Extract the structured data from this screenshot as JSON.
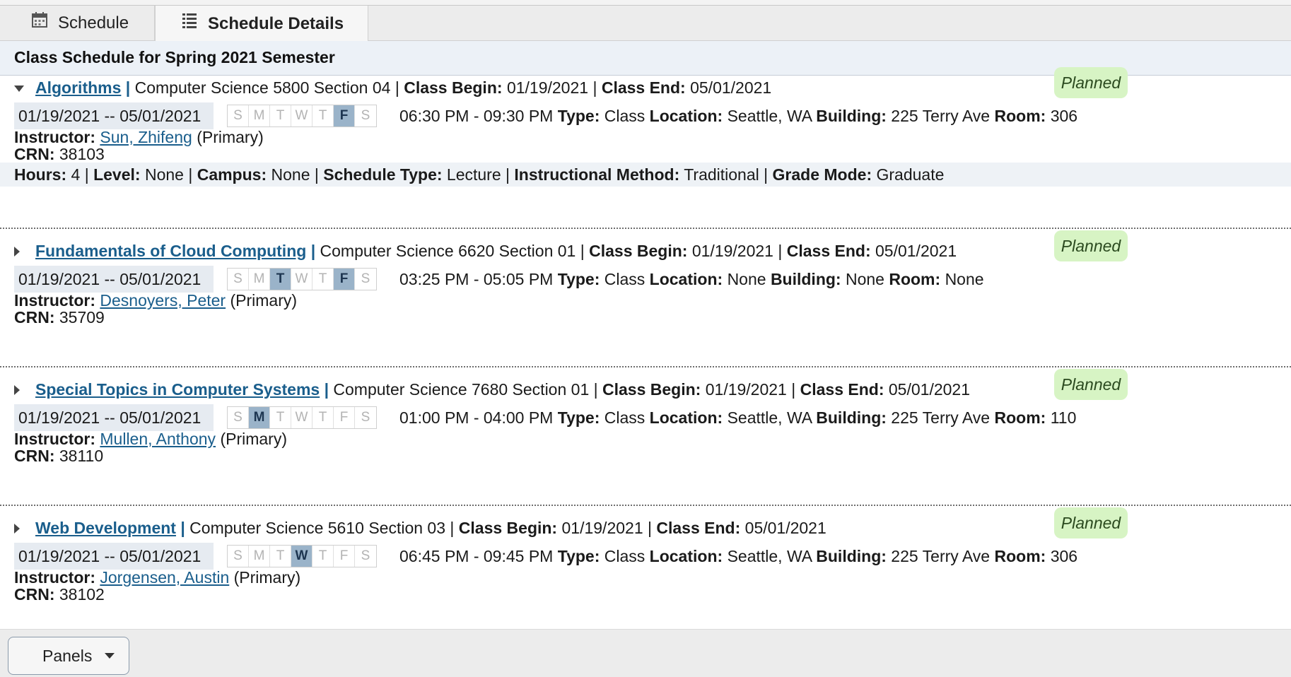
{
  "tabs": [
    {
      "label": "Schedule",
      "icon": "calendar-icon"
    },
    {
      "label": "Schedule Details",
      "icon": "list-icon"
    }
  ],
  "header": {
    "title": "Class Schedule for Spring 2021 Semester"
  },
  "labels": {
    "class_begin": "Class Begin:",
    "class_end": "Class End:",
    "type": "Type:",
    "location": "Location:",
    "building": "Building:",
    "room": "Room:",
    "instructor": "Instructor:",
    "crn": "CRN:",
    "hours": "Hours:",
    "level": "Level:",
    "campus": "Campus:",
    "schedule_type": "Schedule Type:",
    "instructional_method": "Instructional Method:",
    "grade_mode": "Grade Mode:",
    "primary": "(Primary)",
    "pipe": "|"
  },
  "day_letters": [
    "S",
    "M",
    "T",
    "W",
    "T",
    "F",
    "S"
  ],
  "courses": [
    {
      "title": "Algorithms",
      "subject_section": "Computer Science 5800 Section 04",
      "class_begin": "01/19/2021",
      "class_end": "05/01/2021",
      "status": "Planned",
      "date_range": "01/19/2021 -- 05/01/2021",
      "active_days": [
        5
      ],
      "time": "06:30 PM - 09:30 PM",
      "type": "Class",
      "location": "Seattle, WA",
      "building": "225 Terry Ave",
      "room": "306",
      "instructor": "Sun, Zhifeng",
      "crn": "38103",
      "expanded": true,
      "hours": "4",
      "level": "None",
      "campus": "None",
      "schedule_type": "Lecture",
      "instructional_method": "Traditional",
      "grade_mode": "Graduate"
    },
    {
      "title": "Fundamentals of Cloud Computing",
      "subject_section": "Computer Science 6620 Section 01",
      "class_begin": "01/19/2021",
      "class_end": "05/01/2021",
      "status": "Planned",
      "date_range": "01/19/2021 -- 05/01/2021",
      "active_days": [
        2,
        5
      ],
      "time": "03:25 PM - 05:05 PM",
      "type": "Class",
      "location": "None",
      "building": "None",
      "room": "None",
      "instructor": "Desnoyers, Peter",
      "crn": "35709",
      "expanded": false
    },
    {
      "title": "Special Topics in Computer Systems",
      "subject_section": "Computer Science 7680 Section 01",
      "class_begin": "01/19/2021",
      "class_end": "05/01/2021",
      "status": "Planned",
      "date_range": "01/19/2021 -- 05/01/2021",
      "active_days": [
        1
      ],
      "time": "01:00 PM - 04:00 PM",
      "type": "Class",
      "location": "Seattle, WA",
      "building": "225 Terry Ave",
      "room": "110",
      "instructor": "Mullen, Anthony",
      "crn": "38110",
      "expanded": false
    },
    {
      "title": "Web Development",
      "subject_section": "Computer Science 5610 Section 03",
      "class_begin": "01/19/2021",
      "class_end": "05/01/2021",
      "status": "Planned",
      "date_range": "01/19/2021 -- 05/01/2021",
      "active_days": [
        3
      ],
      "time": "06:45 PM - 09:45 PM",
      "type": "Class",
      "location": "Seattle, WA",
      "building": "225 Terry Ave",
      "room": "306",
      "instructor": "Jorgensen, Austin",
      "crn": "38102",
      "expanded": false
    }
  ],
  "footer": {
    "panels_label": "Panels"
  },
  "colors": {
    "link": "#1a5e8c",
    "badge": "#d7f4c4",
    "active_day": "#9ab3c9",
    "header_bg": "#ecf1f7"
  }
}
